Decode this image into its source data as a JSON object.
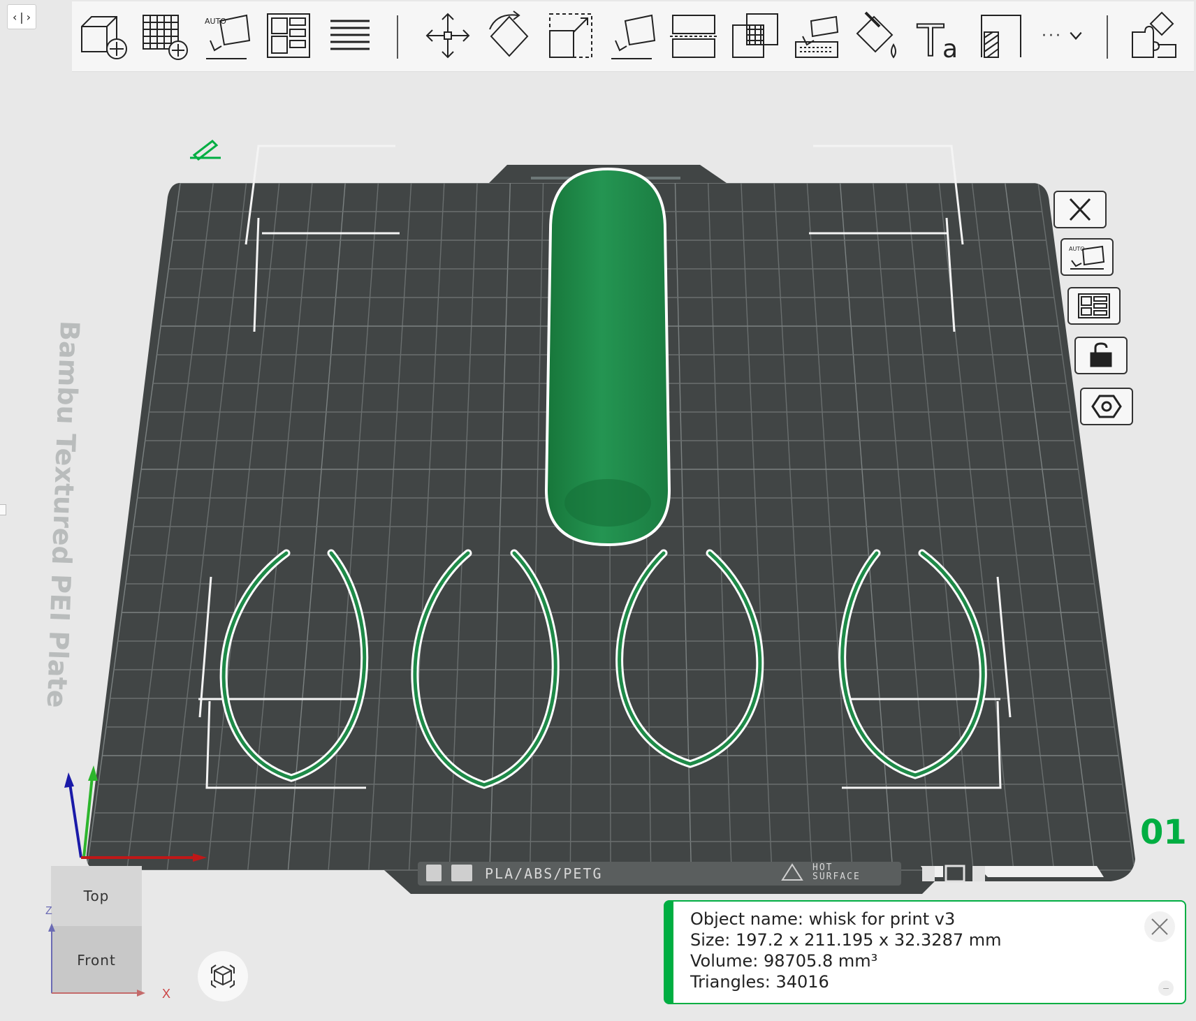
{
  "collapse_button": {
    "label": "‹|›"
  },
  "toolbar": {
    "tools": [
      {
        "name": "add-object",
        "icon": "cube-add-icon"
      },
      {
        "name": "add-plate",
        "icon": "grid-add-icon"
      },
      {
        "name": "auto-orient",
        "icon": "auto-orient-icon",
        "badge": "AUTO"
      },
      {
        "name": "arrange",
        "icon": "arrange-icon"
      },
      {
        "name": "layers",
        "icon": "layers-icon"
      },
      {
        "name": "move",
        "icon": "move-icon"
      },
      {
        "name": "rotate",
        "icon": "rotate-icon"
      },
      {
        "name": "scale",
        "icon": "scale-icon"
      },
      {
        "name": "lay-on-face",
        "icon": "lay-on-face-icon"
      },
      {
        "name": "cut",
        "icon": "cut-icon"
      },
      {
        "name": "boolean",
        "icon": "boolean-icon"
      },
      {
        "name": "support-paint",
        "icon": "support-paint-icon"
      },
      {
        "name": "color-paint",
        "icon": "color-paint-icon"
      },
      {
        "name": "text",
        "icon": "text-icon"
      },
      {
        "name": "seam-paint",
        "icon": "seam-paint-icon"
      }
    ],
    "more_label": "···",
    "assembly_icon": "assembly-icon"
  },
  "plate": {
    "label": "Bambu Textured PEI Plate",
    "number": "01",
    "strip_text": "PLA/ABS/PETG",
    "hot_surface_line1": "HOT",
    "hot_surface_line2": "SURFACE"
  },
  "plate_side_buttons": [
    {
      "name": "delete-plate",
      "icon": "close-icon"
    },
    {
      "name": "auto-orient-plate",
      "icon": "auto-orient-icon",
      "badge": "AUTO"
    },
    {
      "name": "arrange-plate",
      "icon": "arrange-icon"
    },
    {
      "name": "lock-plate",
      "icon": "lock-icon"
    },
    {
      "name": "plate-settings",
      "icon": "hexagon-settings-icon"
    }
  ],
  "view_cube": {
    "top_label": "Top",
    "front_label": "Front",
    "axis_z": "Z",
    "axis_x": "X"
  },
  "object_info": {
    "name_line": "Object name: whisk for print v3",
    "size_line": "Size: 197.2 x 211.195 x 32.3287 mm",
    "volume_line": "Volume: 98705.8 mm³",
    "triangles_line": "Triangles: 34016"
  },
  "colors": {
    "accent": "#00ae42",
    "plate": "#414545",
    "grid": "#6b7070",
    "object": "#1e8a48"
  }
}
